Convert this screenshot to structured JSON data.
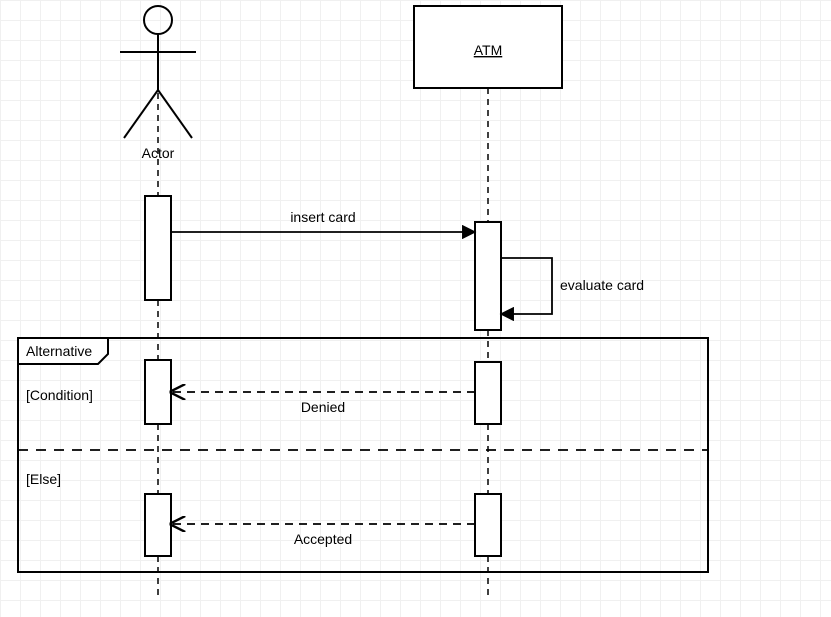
{
  "actor": {
    "label": "Actor"
  },
  "participant": {
    "name": "ATM"
  },
  "messages": {
    "insert": "insert card",
    "evaluate": "evaluate card",
    "denied": "Denied",
    "accepted": "Accepted"
  },
  "frame": {
    "title": "Alternative",
    "condition": "[Condition]",
    "else": "[Else]"
  }
}
